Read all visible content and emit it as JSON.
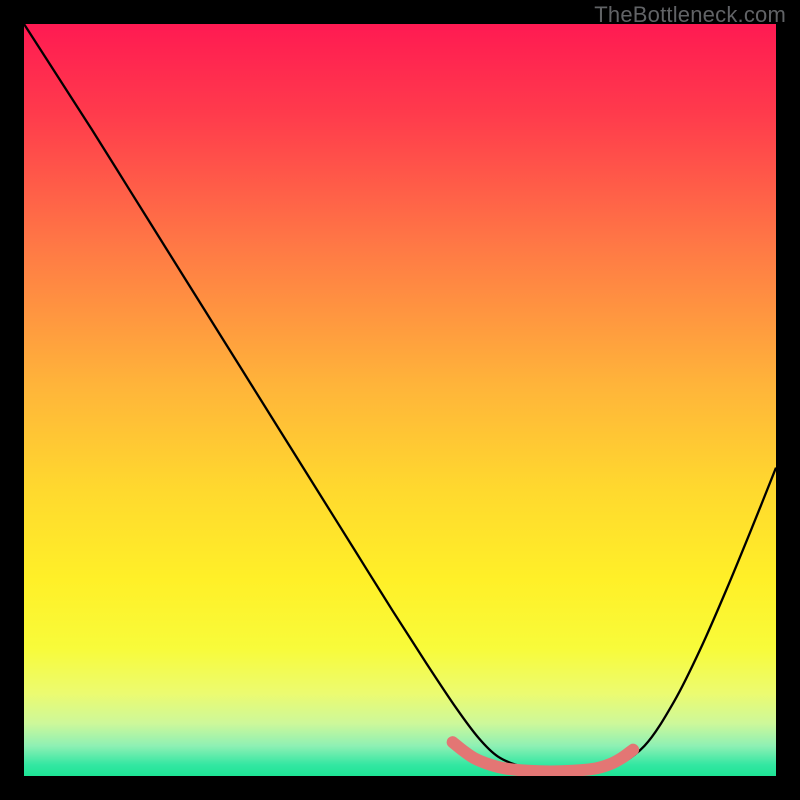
{
  "watermark": "TheBottleneck.com",
  "chart_data": {
    "type": "line",
    "title": "",
    "xlabel": "",
    "ylabel": "",
    "xlim": [
      0,
      100
    ],
    "ylim": [
      0,
      100
    ],
    "grid": false,
    "legend": false,
    "gradient_stops": [
      {
        "offset": 0.0,
        "color": "#ff1a52"
      },
      {
        "offset": 0.12,
        "color": "#ff3b4c"
      },
      {
        "offset": 0.3,
        "color": "#ff7a45"
      },
      {
        "offset": 0.48,
        "color": "#ffb43a"
      },
      {
        "offset": 0.62,
        "color": "#ffd92e"
      },
      {
        "offset": 0.74,
        "color": "#fff028"
      },
      {
        "offset": 0.83,
        "color": "#f8fb3a"
      },
      {
        "offset": 0.89,
        "color": "#ecfb70"
      },
      {
        "offset": 0.93,
        "color": "#cdf89a"
      },
      {
        "offset": 0.96,
        "color": "#8ef0b4"
      },
      {
        "offset": 0.985,
        "color": "#34e7a2"
      },
      {
        "offset": 1.0,
        "color": "#1de495"
      }
    ],
    "series": [
      {
        "name": "bottleneck-curve",
        "color": "#000000",
        "stroke_width": 2.3,
        "x": [
          0.0,
          4.5,
          9.0,
          14.0,
          19.0,
          24.0,
          29.0,
          34.0,
          39.0,
          44.0,
          49.0,
          53.5,
          57.5,
          60.5,
          63.0,
          66.0,
          70.0,
          74.0,
          78.0,
          82.5,
          86.5,
          90.0,
          93.5,
          97.0,
          100.0
        ],
        "values": [
          100.0,
          93.0,
          86.0,
          78.0,
          70.0,
          62.0,
          54.0,
          46.0,
          38.0,
          30.0,
          22.0,
          15.0,
          9.0,
          5.0,
          2.6,
          1.3,
          0.5,
          0.5,
          1.0,
          4.0,
          10.0,
          17.0,
          25.0,
          33.5,
          41.0
        ]
      },
      {
        "name": "optimal-zone-highlight",
        "color": "#e37674",
        "stroke_width": 12,
        "linecap": "round",
        "x": [
          57.0,
          58.5,
          60.0,
          62.0,
          64.0,
          67.0,
          70.0,
          73.0,
          76.0,
          78.0,
          79.5,
          81.0
        ],
        "values": [
          4.5,
          3.3,
          2.3,
          1.5,
          1.0,
          0.7,
          0.6,
          0.7,
          1.0,
          1.6,
          2.4,
          3.5
        ]
      }
    ]
  }
}
